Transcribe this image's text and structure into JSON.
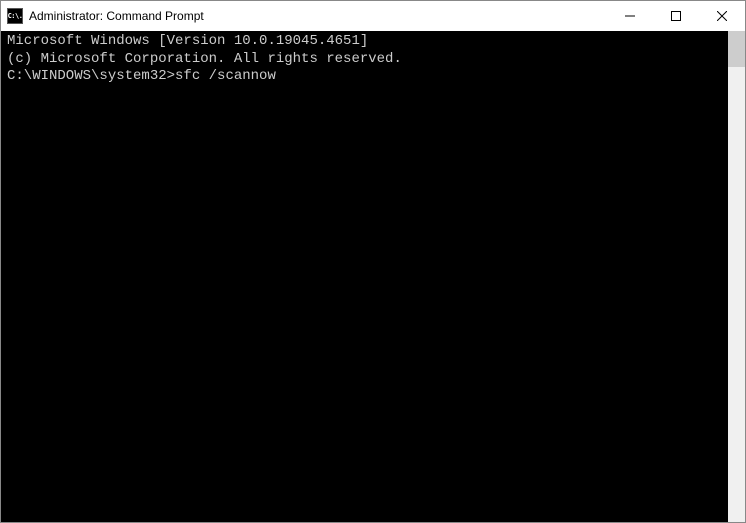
{
  "window": {
    "title": "Administrator: Command Prompt",
    "icon_text": "C:\\."
  },
  "terminal": {
    "line1": "Microsoft Windows [Version 10.0.19045.4651]",
    "line2": "(c) Microsoft Corporation. All rights reserved.",
    "blank": "",
    "prompt": "C:\\WINDOWS\\system32>",
    "command": "sfc /scannow"
  }
}
